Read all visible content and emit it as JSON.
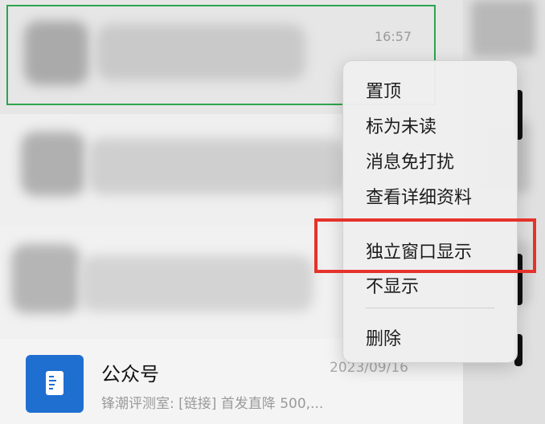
{
  "chat_list": {
    "rows": [
      {
        "time": "16:57"
      }
    ],
    "official_accounts": {
      "title": "公众号",
      "date": "2023/09/16",
      "preview": "锋潮评测室: [链接] 首发直降 500,..."
    }
  },
  "context_menu": {
    "items": [
      {
        "label": "置顶"
      },
      {
        "label": "标为未读"
      },
      {
        "label": "消息免打扰"
      },
      {
        "label": "查看详细资料"
      },
      {
        "label": "独立窗口显示"
      },
      {
        "label": "不显示"
      },
      {
        "label": "删除"
      }
    ]
  },
  "colors": {
    "selection_border": "#2ea44f",
    "highlight_box": "#e5322b",
    "oa_icon_bg": "#1f6fd1"
  }
}
